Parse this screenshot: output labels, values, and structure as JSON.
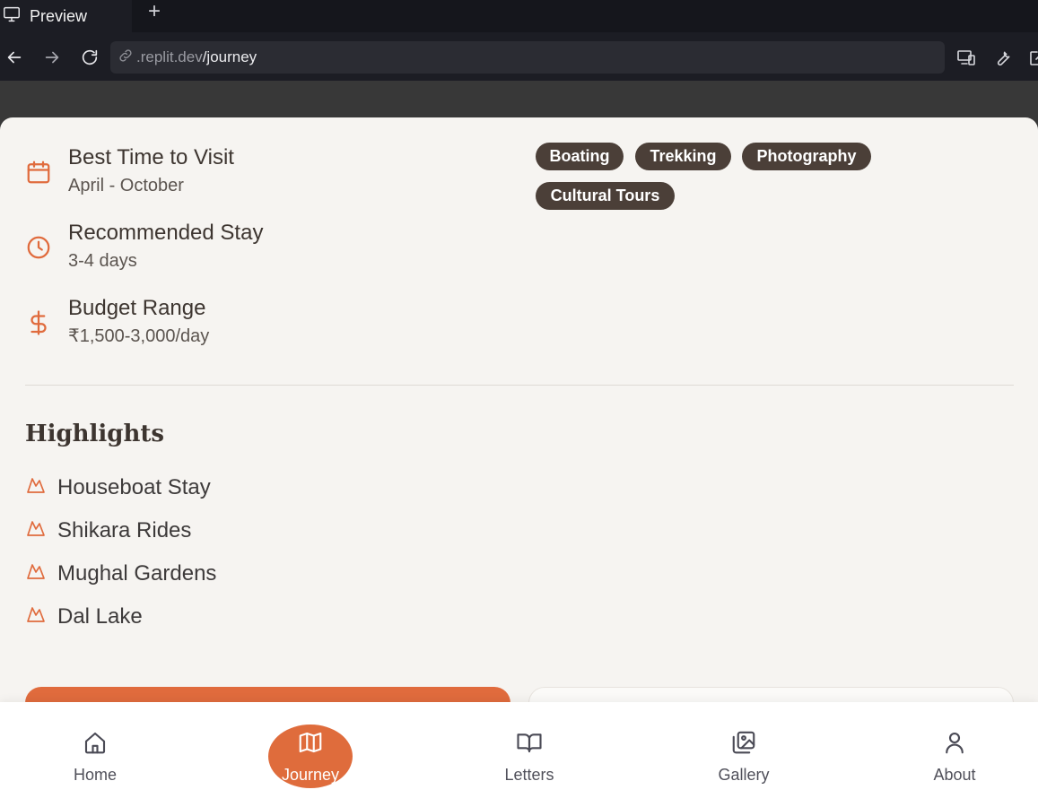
{
  "browser": {
    "tab_title": "Preview",
    "new_tab_symbol": "+",
    "url_host": ".replit.dev",
    "url_path": "/journey"
  },
  "info": {
    "best_time": {
      "title": "Best Time to Visit",
      "value": "April - October",
      "icon": "calendar-icon"
    },
    "stay": {
      "title": "Recommended Stay",
      "value": "3-4 days",
      "icon": "clock-icon"
    },
    "budget": {
      "title": "Budget Range",
      "value": "₹1,500-3,000/day",
      "icon": "dollar-icon"
    }
  },
  "tags": [
    "Boating",
    "Trekking",
    "Photography",
    "Cultural Tours"
  ],
  "highlights": {
    "heading": "Highlights",
    "items": [
      "Houseboat Stay",
      "Shikara Rides",
      "Mughal Gardens",
      "Dal Lake"
    ],
    "icon": "mountain-icon"
  },
  "bottom_nav": {
    "items": [
      {
        "label": "Home",
        "icon": "home-icon"
      },
      {
        "label": "Journey",
        "icon": "map-icon"
      },
      {
        "label": "Letters",
        "icon": "book-open-icon"
      },
      {
        "label": "Gallery",
        "icon": "images-icon"
      },
      {
        "label": "About",
        "icon": "user-icon"
      }
    ],
    "active": "Journey"
  },
  "colors": {
    "accent": "#e06b3d",
    "tag_bg": "#4b3f38",
    "sheet_bg": "#f6f4f1",
    "text_dark": "#3d3530"
  }
}
